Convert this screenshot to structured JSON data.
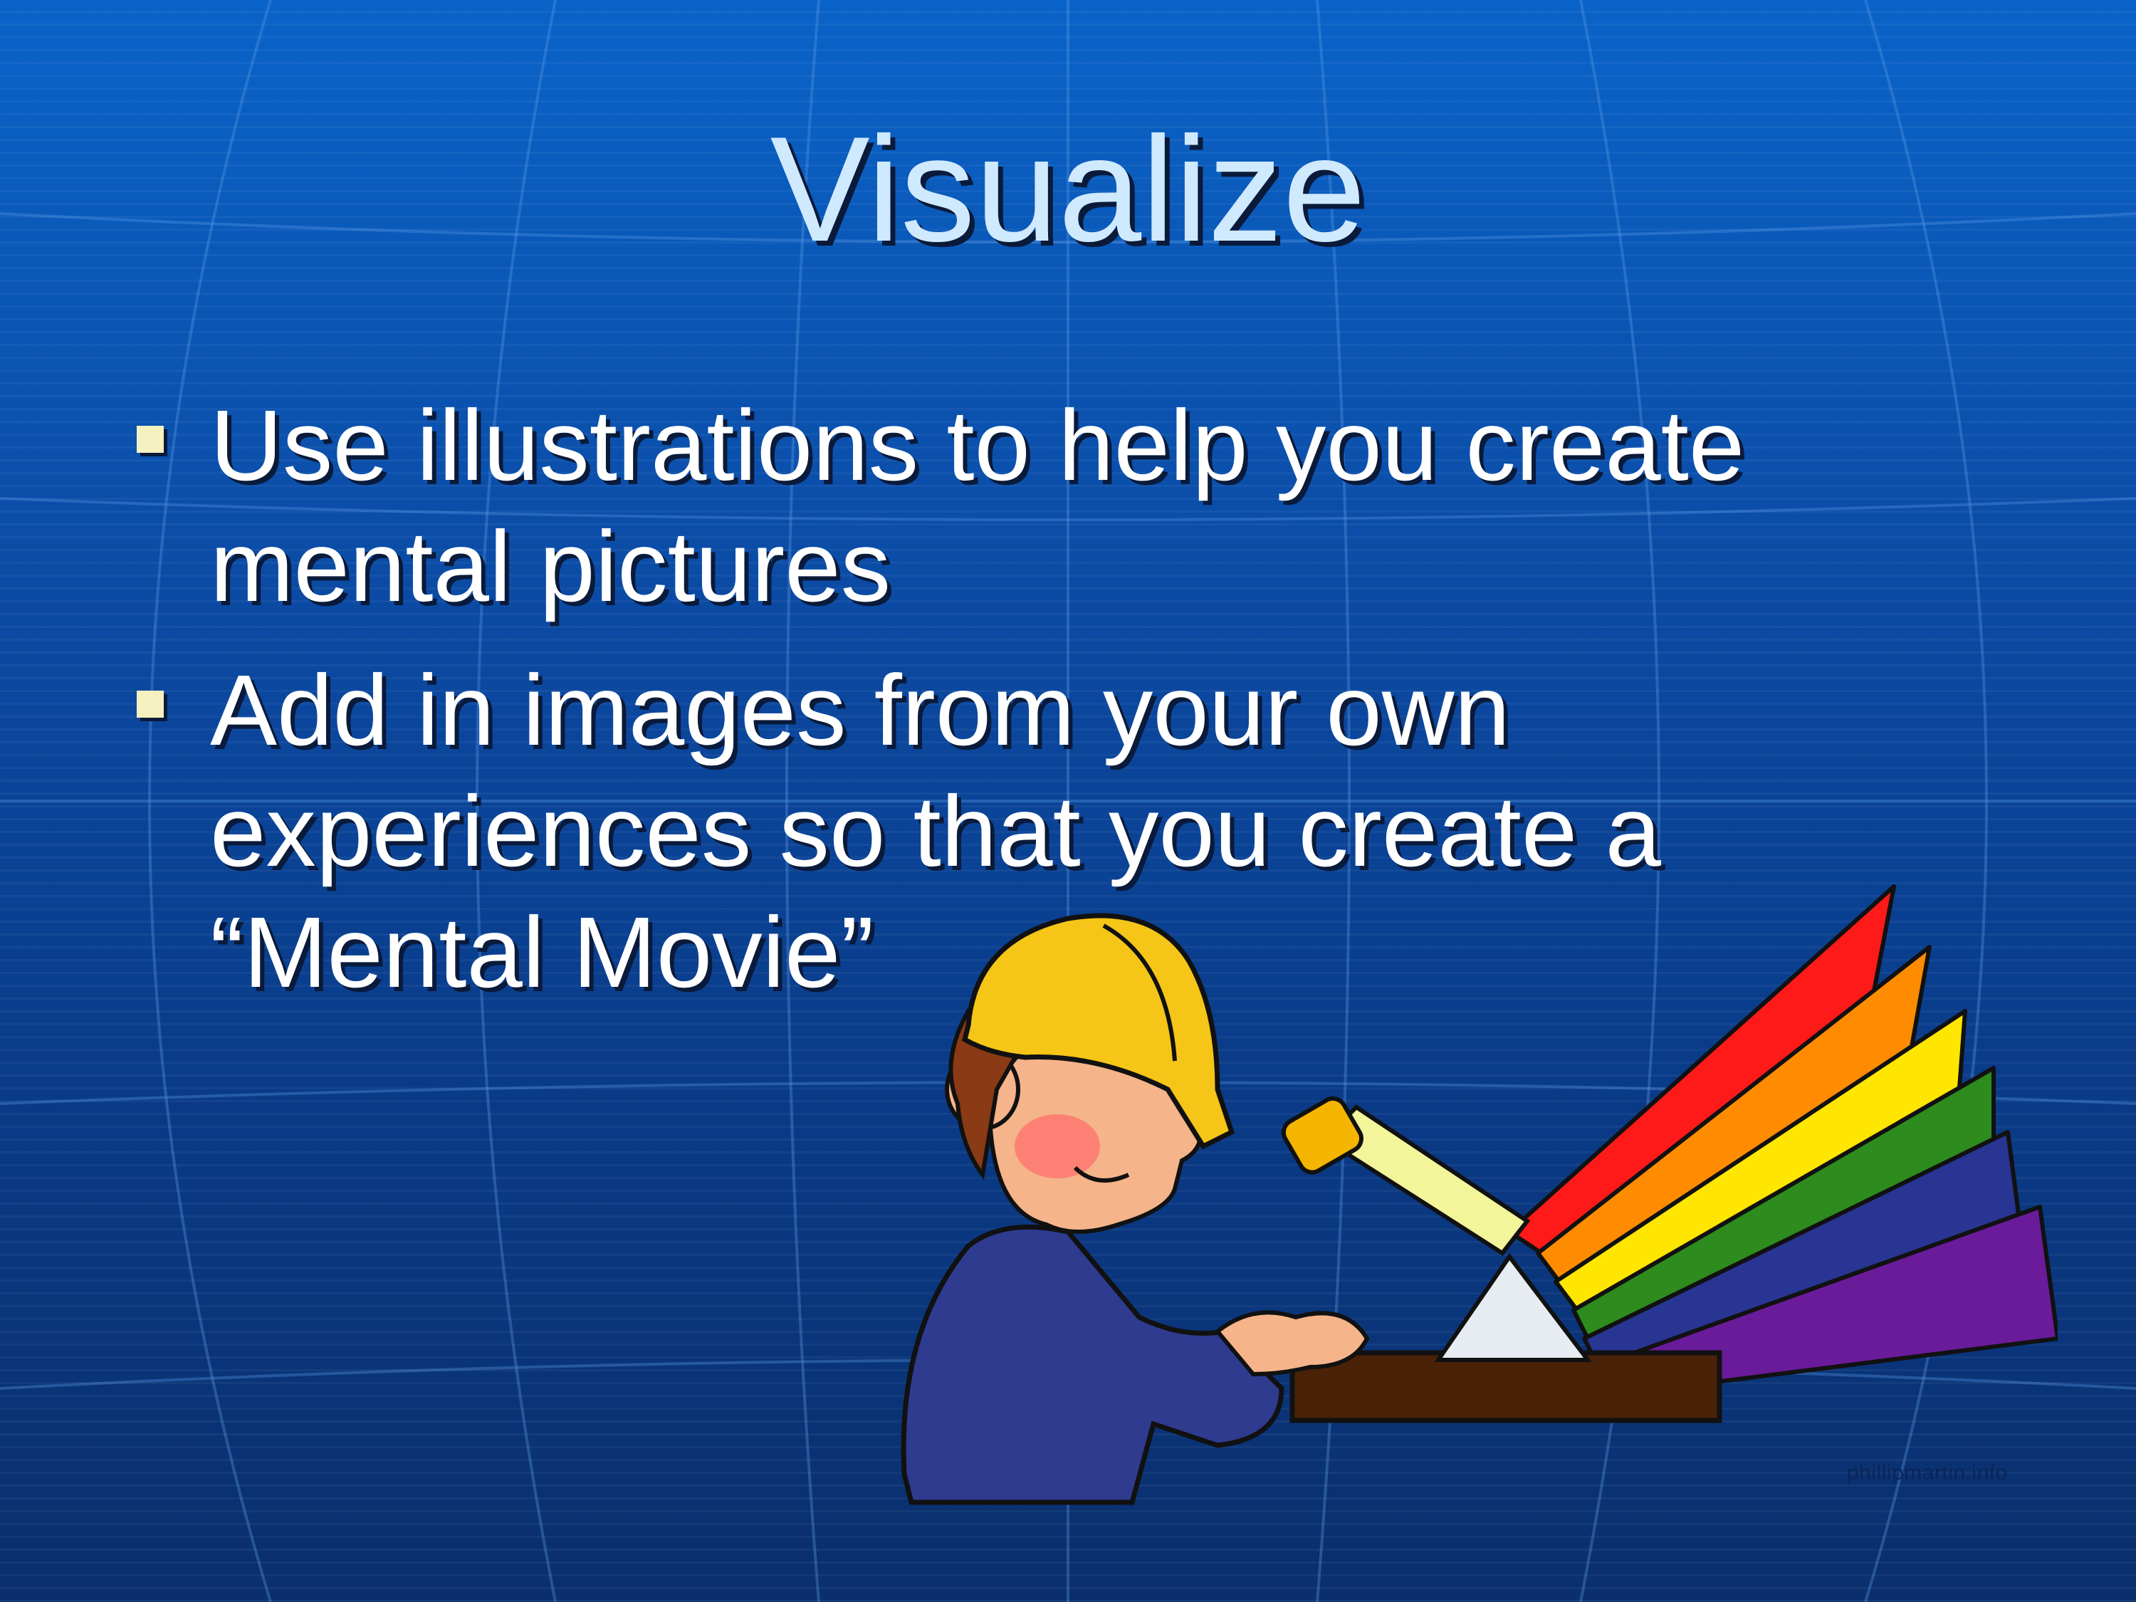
{
  "slide": {
    "title": "Visualize",
    "bullets": [
      "Use illustrations to help you create mental pictures",
      "Add in images from your own experiences so that you create a “Mental Movie”"
    ],
    "credit": "phillipmartin.info"
  },
  "illustration": {
    "subject": "scientist with hard-hat headlamp shining light through a prism",
    "spectrum_colors": [
      "#ff1a1a",
      "#ff8c00",
      "#ffe600",
      "#2e8b1e",
      "#283593",
      "#6a1b9a"
    ]
  }
}
